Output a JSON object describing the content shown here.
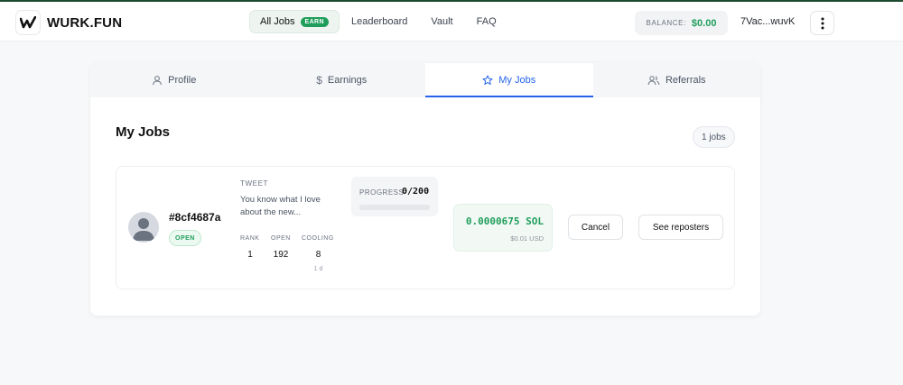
{
  "app": {
    "name": "WURK.FUN"
  },
  "nav": {
    "items": [
      {
        "label": "All Jobs",
        "badge": "EARN",
        "active": true
      },
      {
        "label": "Leaderboard"
      },
      {
        "label": "Vault"
      },
      {
        "label": "FAQ"
      }
    ]
  },
  "account": {
    "balance_label": "BALANCE:",
    "balance_value": "$0.00",
    "wallet": "7Vac...wuvK"
  },
  "tabs": [
    {
      "label": "Profile",
      "icon": "user-icon"
    },
    {
      "label": "Earnings",
      "icon": "dollar-icon"
    },
    {
      "label": "My Jobs",
      "icon": "star-icon",
      "active": true
    },
    {
      "label": "Referrals",
      "icon": "users-icon"
    }
  ],
  "main": {
    "title": "My Jobs",
    "count": "1 jobs"
  },
  "job": {
    "id": "#8cf4687a",
    "status": "OPEN",
    "tweet_label": "TWEET",
    "tweet_text": "You know what I love about the new...",
    "stats": [
      {
        "label": "RANK",
        "value": "1"
      },
      {
        "label": "OPEN",
        "value": "192"
      },
      {
        "label": "COOLING",
        "value": "8",
        "sub": "1 d"
      }
    ],
    "progress_label": "PROGRESS",
    "progress_value": "0/200",
    "progress_fraction": 0,
    "amount_sol": "0.0000675 SOL",
    "amount_usd": "$0.01 USD",
    "cancel_label": "Cancel",
    "reposters_label": "See reposters"
  },
  "colors": {
    "accent_green": "#1f9e5b",
    "accent_blue": "#2563eb",
    "header_border": "#1d4d2e"
  }
}
